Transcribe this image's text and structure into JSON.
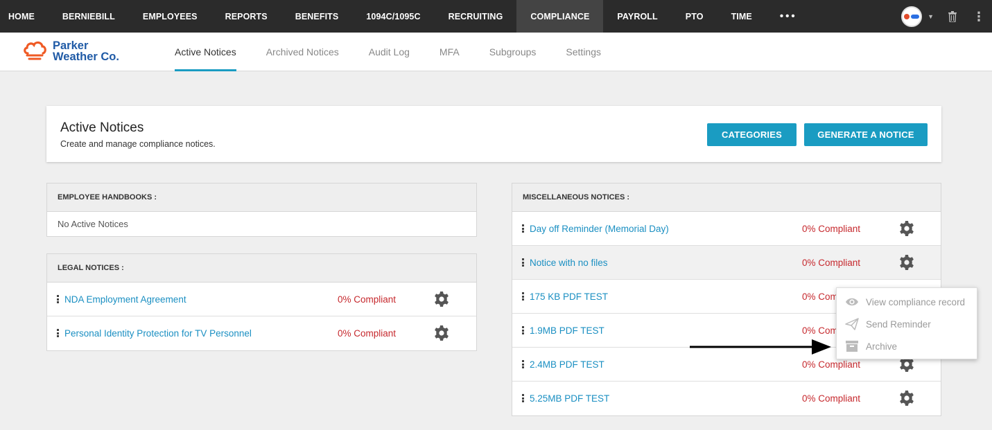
{
  "topnav": {
    "items": [
      "HOME",
      "BERNIEBILL",
      "EMPLOYEES",
      "REPORTS",
      "BENEFITS",
      "1094C/1095C",
      "RECRUITING",
      "COMPLIANCE",
      "PAYROLL",
      "PTO",
      "TIME"
    ],
    "active": "COMPLIANCE",
    "more": "•••"
  },
  "logo": {
    "line1": "Parker",
    "line2": "Weather Co."
  },
  "tabs": [
    "Active Notices",
    "Archived Notices",
    "Audit Log",
    "MFA",
    "Subgroups",
    "Settings"
  ],
  "header": {
    "title": "Active Notices",
    "subtitle": "Create and manage compliance notices.",
    "categories_label": "CATEGORIES",
    "generate_label": "GENERATE A NOTICE"
  },
  "handbooks": {
    "title": "EMPLOYEE HANDBOOKS :",
    "empty": "No Active Notices"
  },
  "legal": {
    "title": "LEGAL NOTICES :",
    "rows": [
      {
        "name": "NDA Employment Agreement",
        "status": "0% Compliant"
      },
      {
        "name": "Personal Identity Protection for TV Personnel",
        "status": "0% Compliant"
      }
    ]
  },
  "misc": {
    "title": "MISCELLANEOUS NOTICES :",
    "rows": [
      {
        "name": "Day off Reminder (Memorial Day)",
        "status": "0% Compliant"
      },
      {
        "name": "Notice with no files",
        "status": "0% Compliant"
      },
      {
        "name": "175 KB PDF TEST",
        "status": "0% Com"
      },
      {
        "name": "1.9MB PDF TEST",
        "status": "0% Com"
      },
      {
        "name": "2.4MB PDF TEST",
        "status": "0% Compliant"
      },
      {
        "name": "5.25MB PDF TEST",
        "status": "0% Compliant"
      }
    ]
  },
  "menu": {
    "view": "View compliance record",
    "remind": "Send Reminder",
    "archive": "Archive"
  },
  "colors": {
    "accent": "#1a9cc2",
    "nav_bg": "#2b2b2b",
    "danger": "#c6282d"
  }
}
